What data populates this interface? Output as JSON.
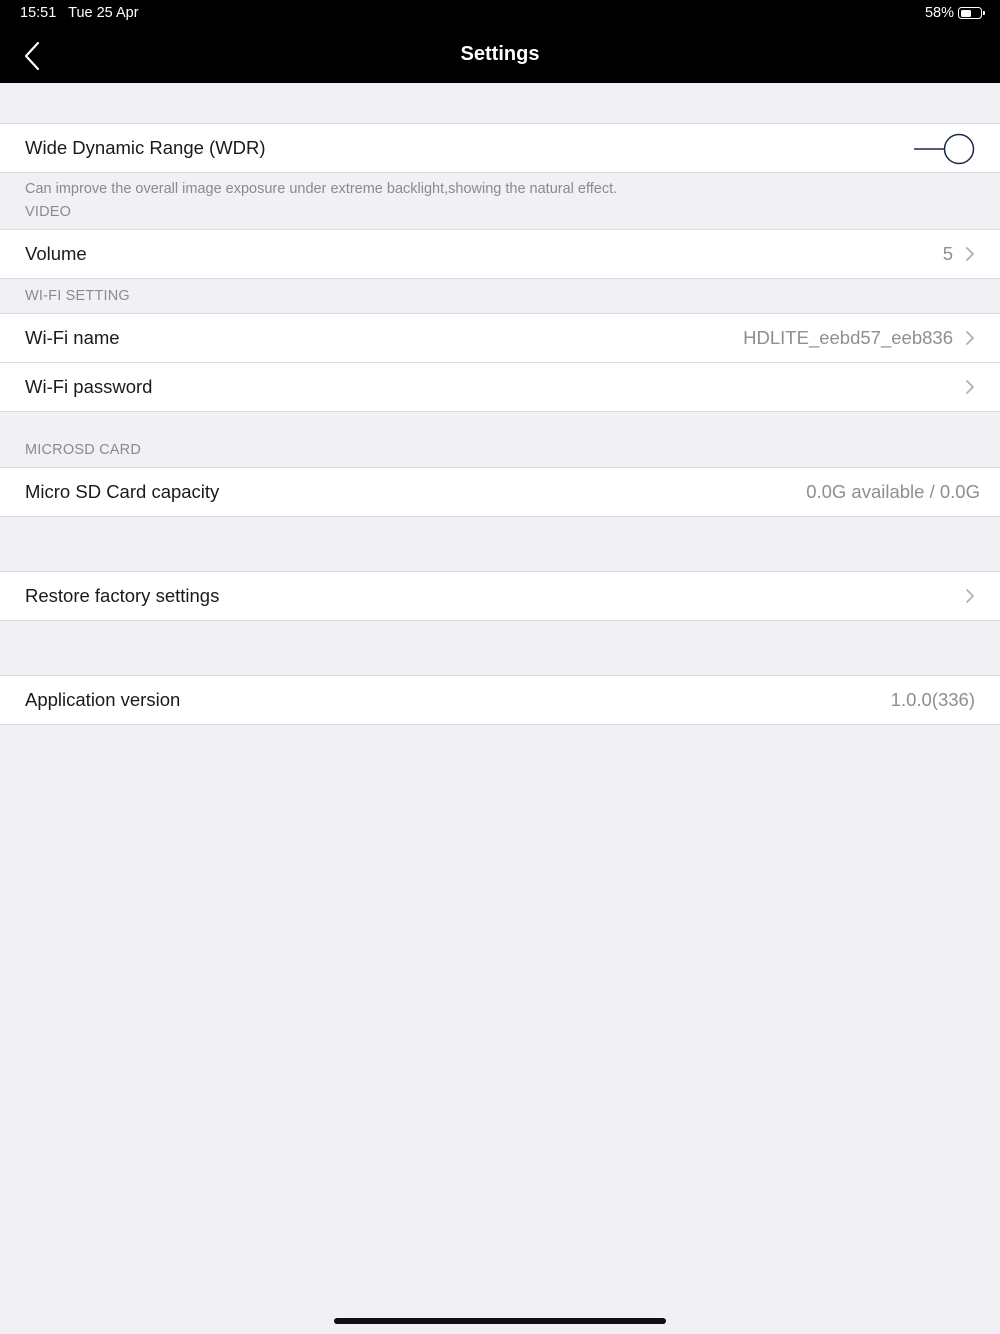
{
  "status_bar": {
    "time": "15:51",
    "date": "Tue 25 Apr",
    "battery": "58%",
    "battery_level": 0.58
  },
  "nav": {
    "title": "Settings",
    "back_icon": "chevron-left-icon"
  },
  "wdr": {
    "label": "Wide Dynamic Range (WDR)",
    "enabled": false,
    "description": "Can improve the overall image exposure under extreme backlight,showing the natural effect."
  },
  "video": {
    "header": "VIDEO",
    "volume": {
      "label": "Volume",
      "value": "5"
    }
  },
  "wifi": {
    "header": "WI-FI SETTING",
    "name": {
      "label": "Wi-Fi name",
      "value": "HDLITE_eebd57_eeb836"
    },
    "password": {
      "label": "Wi-Fi password"
    }
  },
  "sd": {
    "header": "MICROSD CARD",
    "capacity": {
      "label": "Micro SD Card capacity",
      "value": "0.0G available / 0.0G"
    }
  },
  "restore": {
    "label": "Restore factory settings"
  },
  "version": {
    "label": "Application version",
    "value": "1.0.0(336)"
  },
  "colors": {
    "nav_bg": "#000000",
    "page_bg": "#f0f0f5",
    "row_bg": "#ffffff",
    "secondary_text": "#8e8e93",
    "toggle_stroke": "#1c2a4a"
  }
}
